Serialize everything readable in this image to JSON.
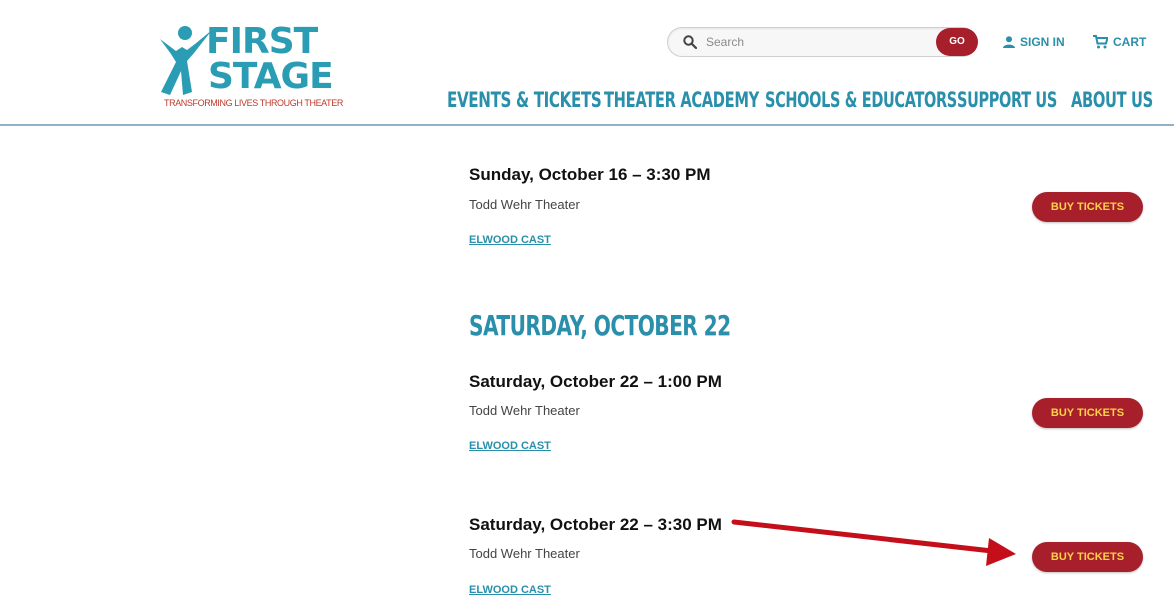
{
  "header": {
    "logo": {
      "line1": "FIRST",
      "line2": "STAGE",
      "tagline": "TRANSFORMING LIVES THROUGH THEATER"
    },
    "search": {
      "placeholder": "Search",
      "go_label": "GO"
    },
    "sign_in_label": "SIGN IN",
    "cart_label": "CART",
    "nav": [
      {
        "label": "EVENTS & TICKETS"
      },
      {
        "label": "THEATER ACADEMY"
      },
      {
        "label": "SCHOOLS & EDUCATORS"
      },
      {
        "label": "SUPPORT US"
      },
      {
        "label": "ABOUT US"
      }
    ]
  },
  "performances": [
    {
      "title": "Sunday, October 16 – 3:30 PM",
      "venue": "Todd Wehr Theater",
      "cast": "ELWOOD CAST",
      "button": "BUY TICKETS"
    },
    {
      "title": "Saturday, October 22 – 1:00 PM",
      "venue": "Todd Wehr Theater",
      "cast": "ELWOOD CAST",
      "button": "BUY TICKETS"
    },
    {
      "title": "Saturday, October 22 – 3:30 PM",
      "venue": "Todd Wehr Theater",
      "cast": "ELWOOD CAST",
      "button": "BUY TICKETS"
    }
  ],
  "date_heading": "SATURDAY, OCTOBER 22",
  "colors": {
    "brand_teal": "#2a8fab",
    "brand_red": "#a61f2b",
    "button_text": "#ffd24a",
    "arrow": "#c40f1a"
  },
  "icons": {
    "search": "search-icon",
    "user": "user-icon",
    "cart": "cart-icon",
    "annotation": "red-arrow-annotation"
  }
}
